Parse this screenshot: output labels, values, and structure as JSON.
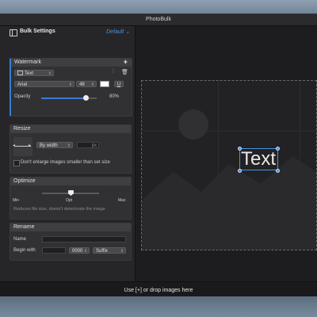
{
  "window": {
    "title": "PhotoBulk"
  },
  "sidebar": {
    "title": "Bulk Settings",
    "preset": "Default ⌄",
    "sidebar_icon": "sidebar-toggle-icon"
  },
  "watermark": {
    "header": "Watermark",
    "add_label": "+",
    "type_value": "Text",
    "font_value": "Arial",
    "size_value": "48",
    "underline_label": "U",
    "opacity_label": "Opacity",
    "opacity_value": "80%",
    "opacity_fraction": 0.8,
    "color": "#ffffff"
  },
  "resize": {
    "header": "Resize",
    "mode_value": "By width",
    "unit": "px",
    "dont_enlarge_label": "Don't enlarge images smaller than set size"
  },
  "optimize": {
    "header": "Optimize",
    "min_label": "Min",
    "opt_label": "Opt",
    "max_label": "Max",
    "hint": "Reduces file size, doesn't deteriorate the image",
    "level_fraction": 0.5
  },
  "rename": {
    "header": "Rename",
    "name_label": "Name",
    "begin_label": "Begin with",
    "number_value": "0000",
    "suffix_value": "Suffix"
  },
  "canvas": {
    "watermark_text": "Text"
  },
  "bottombar": {
    "drop_label": "Use [+] or drop images here"
  },
  "colors": {
    "accent": "#4a90e2",
    "panel": "#313133",
    "sidebar": "#262628"
  }
}
